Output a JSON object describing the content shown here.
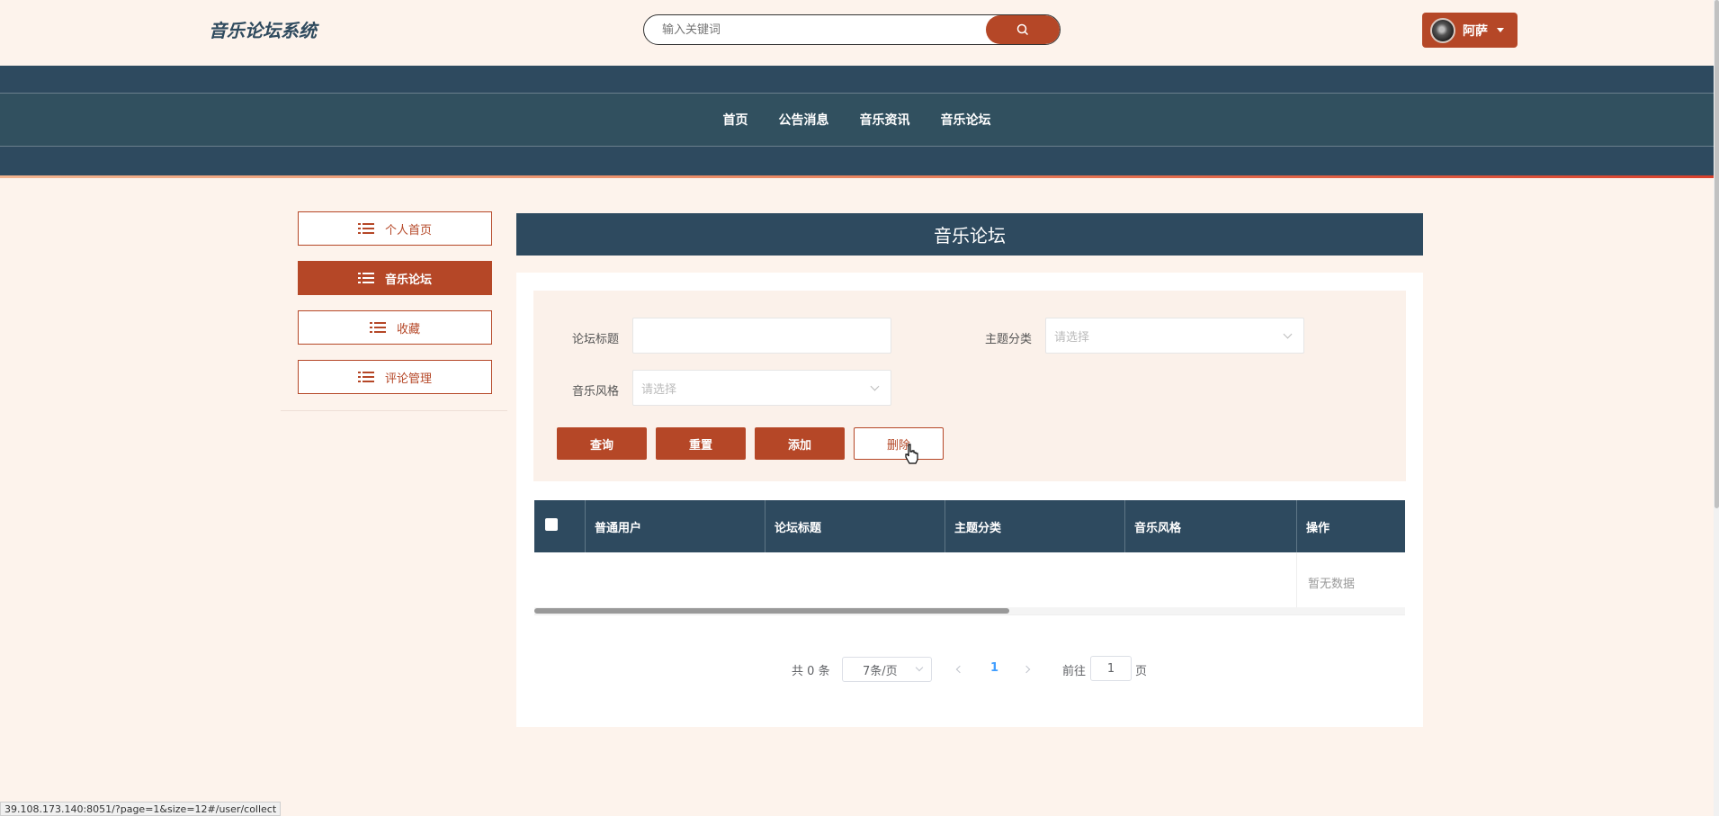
{
  "header": {
    "site_title": "音乐论坛系统",
    "search_placeholder": "输入关键词",
    "search_icon": "search-icon",
    "user_name": "阿萨"
  },
  "nav": {
    "items": [
      "首页",
      "公告消息",
      "音乐资讯",
      "音乐论坛"
    ]
  },
  "sidebar": {
    "items": [
      {
        "label": "个人首页",
        "icon": "list-icon",
        "active": false
      },
      {
        "label": "音乐论坛",
        "icon": "list-icon",
        "active": true
      },
      {
        "label": "收藏",
        "icon": "list-icon",
        "active": false
      },
      {
        "label": "评论管理",
        "icon": "list-icon",
        "active": false
      }
    ]
  },
  "main": {
    "title": "音乐论坛",
    "filters": {
      "title_label": "论坛标题",
      "title_value": "",
      "topic_label": "主题分类",
      "topic_placeholder": "请选择",
      "style_label": "音乐风格",
      "style_placeholder": "请选择"
    },
    "actions": {
      "query": "查询",
      "reset": "重置",
      "add": "添加",
      "delete": "删除"
    },
    "table": {
      "columns": [
        "普通用户",
        "论坛标题",
        "主题分类",
        "音乐风格",
        "操作"
      ],
      "empty_text": "暂无数据"
    },
    "pagination": {
      "total_prefix": "共",
      "total": "0",
      "total_suffix": "条",
      "page_size": "7条/页",
      "current_page": "1",
      "goto_prefix": "前往",
      "goto_value": "1",
      "goto_suffix": "页"
    }
  },
  "status_url": "39.108.173.140:8051/?page=1&size=12#/user/collect",
  "colors": {
    "accent": "#b54727",
    "navy": "#2e4a5f",
    "background": "#fdf3ec"
  }
}
